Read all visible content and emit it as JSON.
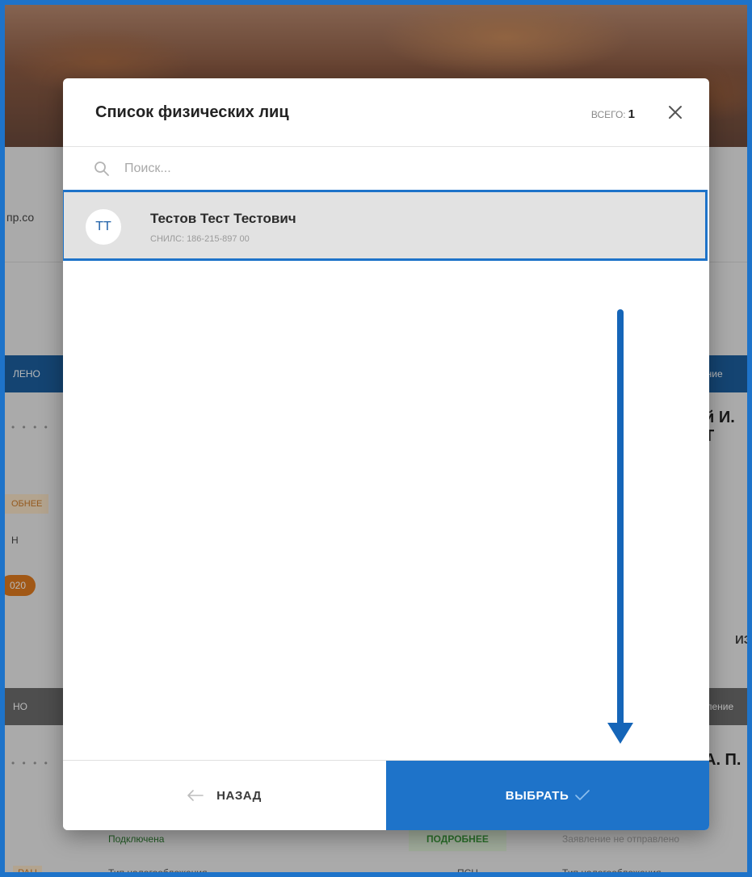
{
  "background": {
    "left_domain_fragment": "пр.со",
    "left_status_fragment": "ЛЕНО",
    "left_dots": "• • • •",
    "left_tag": "ОБНЕЕ",
    "left_letter": "Н",
    "left_pill": "020",
    "left_grey_fragment": "НО",
    "left_bottom_tag": "РАН",
    "right_head_fragment": "ение",
    "right_name_1": "й И. Т",
    "right_edit_fragment": "ИЗ",
    "right_grey_fragment": "пление",
    "right_name_2": "А. П.",
    "bottom_status_left": "Подключена",
    "bottom_more": "ПОДРОБНЕЕ",
    "bottom_status_right": "Заявление не отправлено",
    "bottom_tax_label_left": "Тип налогообложения",
    "bottom_tax_value": "ПСН",
    "bottom_tax_label_right": "Тип налогообложения"
  },
  "modal": {
    "title": "Список физических лиц",
    "total_label": "ВСЕГО:",
    "total_count": "1",
    "search_placeholder": "Поиск...",
    "people": [
      {
        "initials": "ТТ",
        "name": "Тестов Тест Тестович",
        "snils": "СНИЛС: 186-215-897 00"
      }
    ],
    "back_label": "НАЗАД",
    "select_label": "ВЫБРАТЬ"
  },
  "colors": {
    "accent": "#1e73c9",
    "arrow": "#1565b8",
    "selected_row_bg": "#e2e2e2"
  },
  "icons": {
    "close": "close-icon",
    "search": "search-icon",
    "back": "arrow-left-icon",
    "select": "check-icon"
  }
}
